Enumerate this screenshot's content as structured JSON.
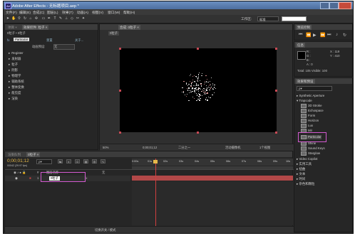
{
  "titlebar": {
    "app_icon": "Ae",
    "title": "Adobe After Effects - 无标题项目.aep *"
  },
  "menu": [
    "文件(F)",
    "编辑(E)",
    "合成(C)",
    "图层(L)",
    "效果(T)",
    "动画(A)",
    "视图(V)",
    "窗口(W)",
    "帮助(H)"
  ],
  "toolbar": {
    "workspace_label": "工作区:",
    "workspace_value": "标准",
    "search_placeholder": ""
  },
  "project_panel": {
    "tabs": [
      "项目 ×",
      "效果控件: 粒子 ×"
    ],
    "breadcrumb": "0粒子 • 0粒子",
    "fx_badge": "fx",
    "effect_name": "Particular",
    "reset_label": "重置",
    "about_label": "关于...",
    "animation_presets_label": "动画预设:",
    "animation_presets_value": "无",
    "properties": [
      "Register",
      "发射器",
      "粒子",
      "阴影",
      "物理学",
      "辅助系统",
      "整体变换",
      "能见度",
      "渲染"
    ]
  },
  "comp_panel": {
    "tab": "合成: 0粒子 ×",
    "sub_tab": "0粒子",
    "zoom": "50%",
    "timecode": "0;00;01;12",
    "resolution": "二分之一",
    "view": "活动摄像机",
    "views": "1个视图"
  },
  "preview_panel": {
    "tab": "预览控制"
  },
  "info_panel": {
    "tab": "信息",
    "r": "R :",
    "g": "G :",
    "b": "B :",
    "a": "A : 0",
    "x": "X : 119",
    "y": "Y : 410",
    "footer": "Total: 105  Visible: 100"
  },
  "effects_panel": {
    "tab": "效果和预设",
    "search_value": "ρ▾",
    "categories_top": [
      "Synthetic Aperture",
      "Trapcode"
    ],
    "trapcode_items": [
      "3D Stroke",
      "Echospace",
      "Form",
      "Horizon",
      "Lux",
      "Mir",
      "Particular",
      "Shine",
      "Sound Keys",
      "Starglow"
    ],
    "highlighted_item": "Particular",
    "categories_bottom": [
      "Video Copilot",
      "实用工具",
      "扭曲",
      "文本",
      "时间",
      "杂色和颗粒"
    ]
  },
  "timeline": {
    "tabs": [
      "渲染队列",
      "0粒子 ×"
    ],
    "timecode": "0;00;01;12",
    "frame_info": "00042 (29.97 fps)",
    "search_value": "ρ▾",
    "col_header": "图层名称",
    "layer_num": "1",
    "layer_name": "0粒子",
    "parent": "无",
    "ruler": [
      "0:00s",
      "01s",
      "02s",
      "03s",
      "04s",
      "05s",
      "06s",
      "07s",
      "08s",
      "09s",
      "10s"
    ],
    "footer": "切换开关 / 模式"
  },
  "colors": {
    "accent": "#d35ad0",
    "playhead": "#d04040",
    "layer_bar": "#b24848",
    "timecode": "#e6b94a"
  },
  "icons": [
    "selection-tool",
    "hand-tool",
    "zoom-tool",
    "rotate-tool",
    "camera-tool",
    "pan-behind-tool",
    "pen-tool",
    "text-tool",
    "brush-tool",
    "clone-tool",
    "eraser-tool",
    "roto-tool",
    "puppet-tool",
    "play-icon",
    "stop-icon"
  ]
}
